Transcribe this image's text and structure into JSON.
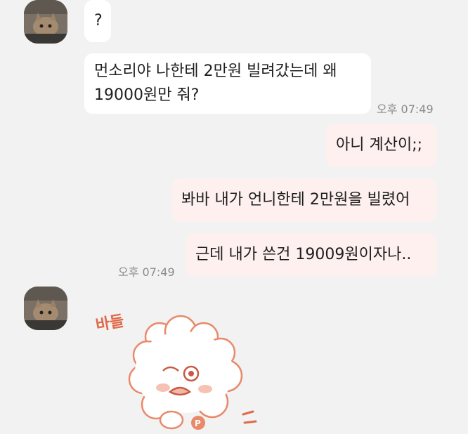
{
  "messages": [
    {
      "sender": "other",
      "text": "?"
    },
    {
      "sender": "other",
      "lines": [
        "먼소리야 나한테 2만원 빌려갔는데 왜",
        "19000원만 줘?"
      ],
      "time": "오후 07:49"
    },
    {
      "sender": "me",
      "text": "아니 계산이;;"
    },
    {
      "sender": "me",
      "text": "봐바 내가 언니한테 2만원을 빌렸어"
    },
    {
      "sender": "me",
      "text": "근데 내가 쓴건 19009원이자나..",
      "time": "오후 07:49"
    }
  ],
  "sticker": {
    "caption": "바들",
    "badge": "P"
  },
  "colors": {
    "background": "#f2f2f2",
    "incoming_bubble": "#ffffff",
    "outgoing_bubble": "#fdf0ef",
    "sticker_stroke": "#e88a6a"
  }
}
